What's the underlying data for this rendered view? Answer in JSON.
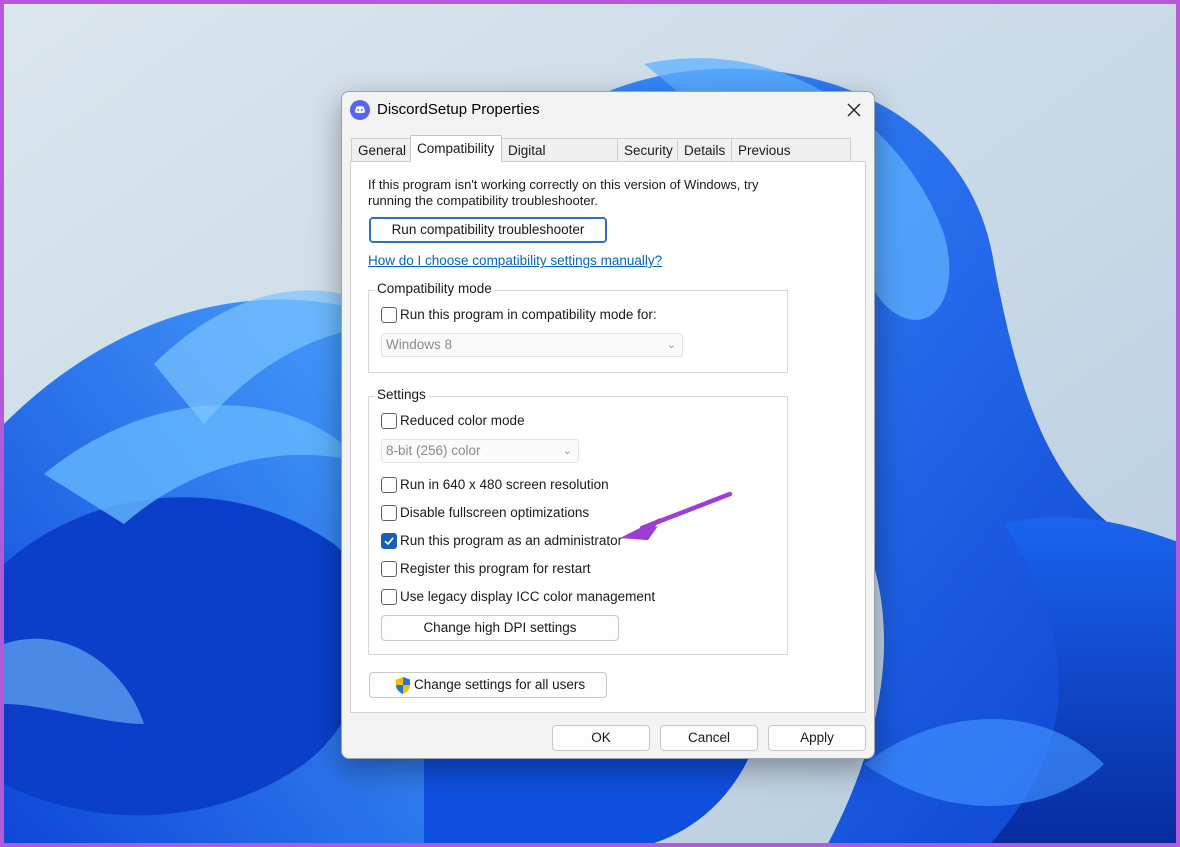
{
  "window": {
    "title": "DiscordSetup Properties",
    "app_icon": "discord-icon",
    "close_icon": "close-icon"
  },
  "tabs": [
    {
      "label": "General",
      "active": false
    },
    {
      "label": "Compatibility",
      "active": true
    },
    {
      "label": "Digital Signatures",
      "active": false
    },
    {
      "label": "Security",
      "active": false
    },
    {
      "label": "Details",
      "active": false
    },
    {
      "label": "Previous Versions",
      "active": false
    }
  ],
  "compat": {
    "intro_line1": "If this program isn't working correctly on this version of Windows, try",
    "intro_line2": "running the compatibility troubleshooter.",
    "troubleshooter_button": "Run compatibility troubleshooter",
    "help_link": "How do I choose compatibility settings manually?",
    "mode_group": {
      "legend": "Compatibility mode",
      "checkbox_label": "Run this program in compatibility mode for:",
      "checked": false,
      "select_value": "Windows 8"
    },
    "settings_group": {
      "legend": "Settings",
      "reduced_color": {
        "label": "Reduced color mode",
        "checked": false
      },
      "color_select_value": "8-bit (256) color",
      "res_640": {
        "label": "Run in 640 x 480 screen resolution",
        "checked": false
      },
      "disable_fullscreen": {
        "label": "Disable fullscreen optimizations",
        "checked": false
      },
      "run_admin": {
        "label": "Run this program as an administrator",
        "checked": true
      },
      "register_restart": {
        "label": "Register this program for restart",
        "checked": false
      },
      "legacy_icc": {
        "label": "Use legacy display ICC color management",
        "checked": false
      },
      "dpi_button": "Change high DPI settings"
    },
    "all_users_button": "Change settings for all users",
    "shield_icon": "uac-shield-icon"
  },
  "footer": {
    "ok": "OK",
    "cancel": "Cancel",
    "apply": "Apply"
  },
  "annotation": {
    "arrow_color": "#9b3ed8",
    "icon": "pointer-arrow-icon"
  },
  "colors": {
    "frame_border": "#b25ad8",
    "accent": "#1b5fb5",
    "link": "#0067c0"
  }
}
